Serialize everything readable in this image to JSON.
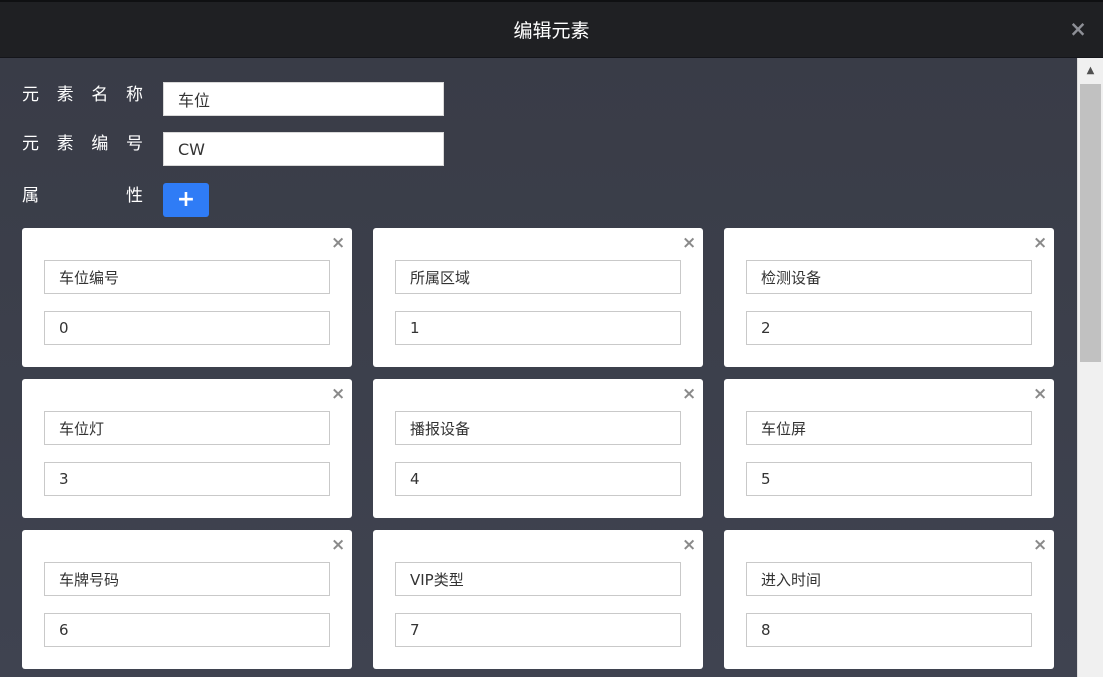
{
  "dialog": {
    "title": "编辑元素",
    "close_icon": "×"
  },
  "form": {
    "name_label": [
      "元",
      "素",
      "名",
      "称"
    ],
    "name_value": "车位",
    "code_label": [
      "元",
      "素",
      "编",
      "号"
    ],
    "code_value": "CW",
    "attr_label": [
      "属",
      "性"
    ],
    "add_label": "+"
  },
  "attributes": [
    {
      "name": "车位编号",
      "value": "0"
    },
    {
      "name": "所属区域",
      "value": "1"
    },
    {
      "name": "检测设备",
      "value": "2"
    },
    {
      "name": "车位灯",
      "value": "3"
    },
    {
      "name": "播报设备",
      "value": "4"
    },
    {
      "name": "车位屏",
      "value": "5"
    },
    {
      "name": "车牌号码",
      "value": "6"
    },
    {
      "name": "VIP类型",
      "value": "7"
    },
    {
      "name": "进入时间",
      "value": "8"
    }
  ],
  "card_close_icon": "×",
  "scroll_up_icon": "▲",
  "colors": {
    "header_bg": "#1f2023",
    "body_bg": "#3b3e49",
    "accent": "#2f7cf6"
  }
}
